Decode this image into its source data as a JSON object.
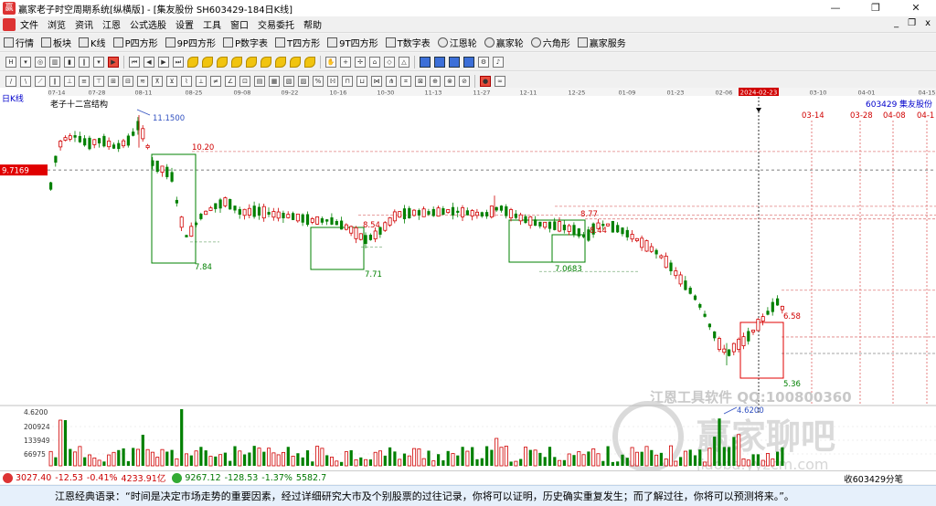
{
  "window": {
    "title": "赢家老子时空周期系统[纵横版] - [集友股份  SH603429-184日K线]",
    "minimize": "—",
    "maximize": "❐",
    "close": "✕"
  },
  "menu": [
    "文件",
    "浏览",
    "资讯",
    "江恩",
    "公式选股",
    "设置",
    "工具",
    "窗口",
    "交易委托",
    "帮助"
  ],
  "mdi": {
    "min": "_",
    "restore": "❐",
    "close": "x"
  },
  "toolbar": [
    {
      "icon": "grid-icon",
      "label": "行情"
    },
    {
      "icon": "blocks-icon",
      "label": "板块"
    },
    {
      "icon": "candle-icon",
      "label": "K线"
    },
    {
      "icon": "square-icon",
      "label": "P四方形"
    },
    {
      "icon": "square-icon",
      "label": "9P四方形"
    },
    {
      "icon": "square-icon",
      "label": "P数字表"
    },
    {
      "icon": "square-icon",
      "label": "T四方形"
    },
    {
      "icon": "square-icon",
      "label": "9T四方形"
    },
    {
      "icon": "square-icon",
      "label": "T数字表"
    },
    {
      "icon": "wheel-icon",
      "label": "江恩轮"
    },
    {
      "icon": "wheel-icon",
      "label": "赢家轮"
    },
    {
      "icon": "star-icon",
      "label": "六角形"
    },
    {
      "icon": "service-icon",
      "label": "赢家服务"
    }
  ],
  "chart": {
    "period_label": "日K线",
    "study_label": "老子十二宫结构",
    "code": "603429",
    "name": "集友股份",
    "date_axis": [
      "07-14",
      "07-28",
      "08-11",
      "08-25",
      "09-08",
      "09-22",
      "10-16",
      "10-30",
      "11-13",
      "11-27",
      "12-11",
      "12-25",
      "01-09",
      "01-23",
      "02-06",
      "2024-02-23",
      "03-10",
      "04-01",
      "04-15"
    ],
    "future_dates": [
      "03-14",
      "03-28",
      "04-08",
      "04-1"
    ],
    "price_tag": "9.7169",
    "price_labels": [
      "11.1500",
      "10.20",
      "7.84",
      "8.54",
      "7.71",
      "8.77",
      "8.44",
      "7.0683",
      "6.58",
      "5.36",
      "4.6200"
    ],
    "watermark": "江恩工具软件  QQ:100800360",
    "watermark2": "赢家聊吧",
    "watermark3": "jiaoba.yyzcm.com",
    "volume_axis": [
      "4.6200",
      "200924",
      "133949",
      "66975"
    ]
  },
  "chart_data": {
    "type": "candlestick",
    "x": [
      "07-14",
      "07-28",
      "08-11",
      "08-25",
      "09-08",
      "09-22",
      "10-16",
      "10-30",
      "11-13",
      "11-27",
      "12-11",
      "12-25",
      "01-09",
      "01-23",
      "02-06",
      "2024-02-23"
    ],
    "annotations": {
      "high": 11.15,
      "low": 4.62,
      "levels": [
        10.2,
        7.84,
        8.54,
        7.71,
        8.77,
        8.44,
        7.0683,
        6.58,
        5.36
      ],
      "current_line": 9.7169
    },
    "volume_ticks": [
      66975,
      133949,
      200924
    ]
  },
  "status": {
    "idx1": "3027.40",
    "idx1_chg": "-12.53",
    "idx1_pct": "-0.41%",
    "idx1_amt": "4233.91亿",
    "idx2": "9267.12",
    "idx2_chg": "-128.53",
    "idx2_pct": "-1.37%",
    "idx2_amt": "5582.7",
    "right": "收603429分笔"
  },
  "quote": "江恩经典语录：“时间是决定市场走势的重要因素，经过详细研究大市及个别股票的过往记录，你将可以证明，历史确实重复发生；而了解过往，你将可以预测将来。”。",
  "colors": {
    "up": "#d00000",
    "down": "#008000",
    "cross": "#000000",
    "box_green": "#008000",
    "box_red": "#e00000"
  }
}
